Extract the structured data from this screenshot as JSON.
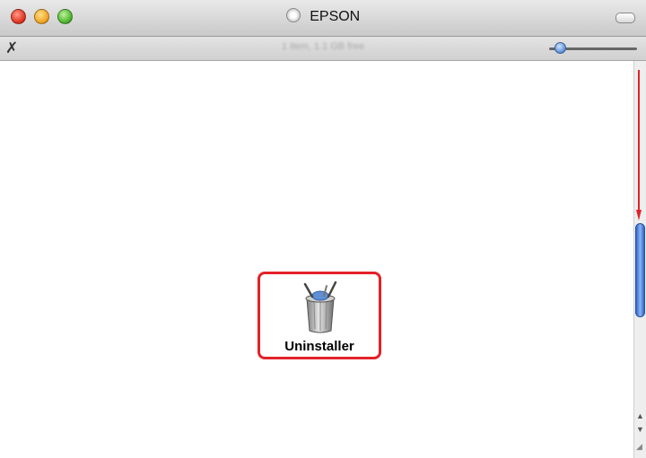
{
  "window": {
    "title": "EPSON"
  },
  "toolbar": {
    "status_text": "1 item, 1.1 GB free"
  },
  "content": {
    "items": [
      {
        "label": "Uninstaller",
        "icon": "trash-can-icon",
        "highlighted": true
      }
    ]
  },
  "annotation": {
    "highlight_color": "#e32229",
    "arrow_color": "#e32229"
  }
}
